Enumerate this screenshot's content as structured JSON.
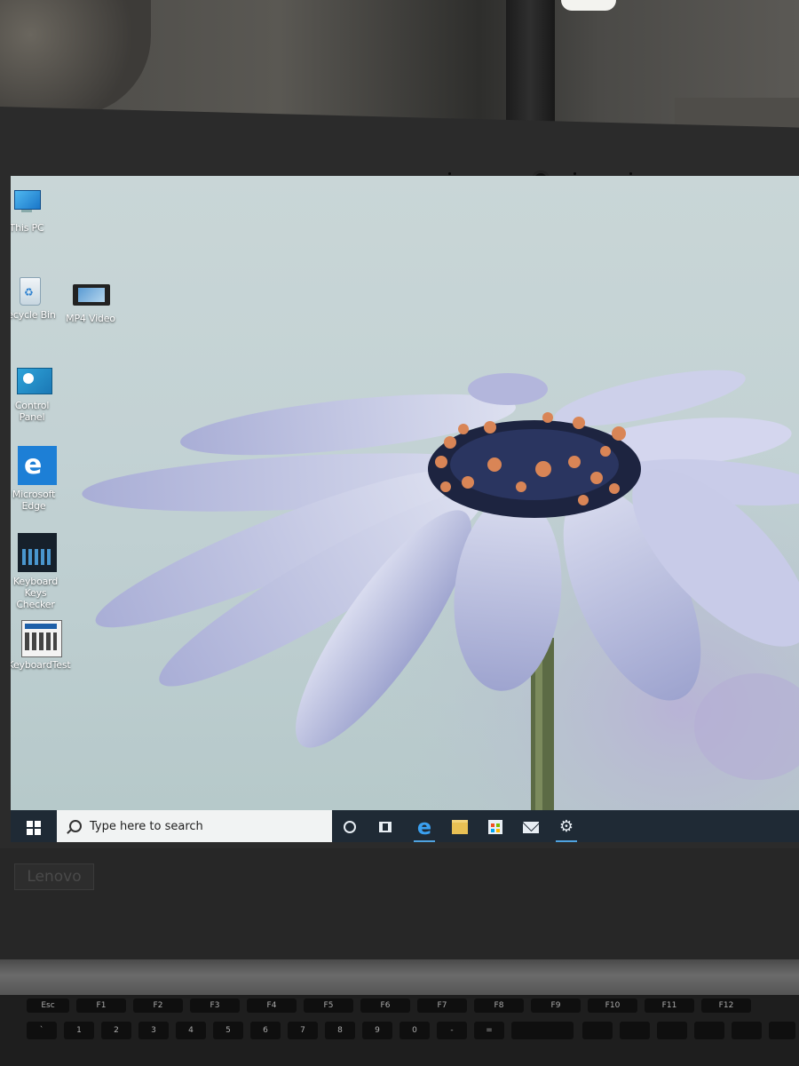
{
  "device": {
    "brand_logo": "Lenovo"
  },
  "desktop": {
    "icons": [
      {
        "label": "This PC",
        "icon": "computer-icon"
      },
      {
        "label": "Recycle Bin",
        "icon": "recycle-bin-icon"
      },
      {
        "label": "MP4 Video",
        "icon": "video-file-icon"
      },
      {
        "label": "Control Panel",
        "icon": "control-panel-icon"
      },
      {
        "label": "Microsoft Edge",
        "icon": "edge-icon"
      },
      {
        "label": "Keyboard Keys Checker",
        "icon": "keyboard-icon"
      },
      {
        "label": "KeyboardTest",
        "icon": "keyboard-test-icon"
      }
    ],
    "wallpaper": "daisy-flower-wallpaper"
  },
  "taskbar": {
    "search_placeholder": "Type here to search",
    "buttons": [
      {
        "name": "cortana",
        "icon": "circle-icon"
      },
      {
        "name": "task-view",
        "icon": "task-view-icon"
      },
      {
        "name": "edge",
        "icon": "edge-icon",
        "active": true
      },
      {
        "name": "file-explorer",
        "icon": "folder-icon"
      },
      {
        "name": "store",
        "icon": "store-bag-icon"
      },
      {
        "name": "mail",
        "icon": "mail-icon"
      },
      {
        "name": "settings",
        "icon": "gear-icon",
        "active": true
      }
    ]
  },
  "keyboard": {
    "fn_row": [
      "Esc",
      "F1",
      "F2",
      "F3",
      "F4",
      "F5",
      "F6",
      "F7",
      "F8",
      "F9",
      "F10",
      "F11",
      "F12"
    ]
  },
  "colors": {
    "taskbar": "#1f2a35",
    "accent": "#4fa3e0",
    "search_box": "#f1f3f3"
  }
}
